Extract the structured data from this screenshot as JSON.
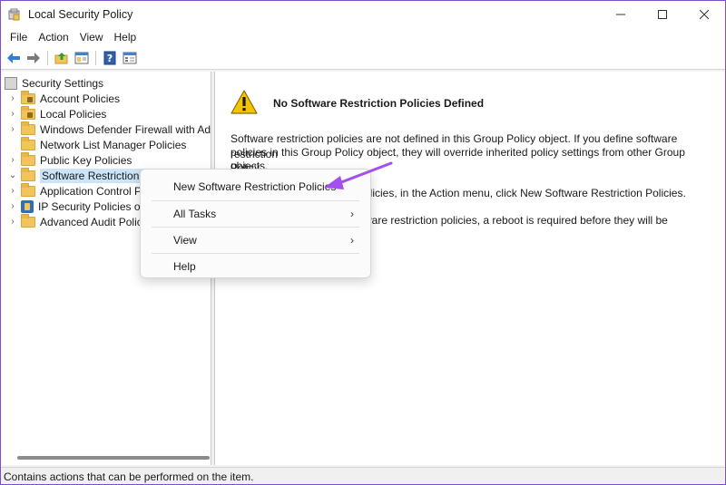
{
  "window": {
    "title": "Local Security Policy",
    "controls": {
      "minimize": "—",
      "maximize": "☐",
      "close": "✕"
    }
  },
  "menubar": {
    "items": [
      "File",
      "Action",
      "View",
      "Help"
    ]
  },
  "toolbar": {
    "buttons": [
      "back-icon",
      "forward-icon",
      "up-folder-icon",
      "show-hide-tree-icon",
      "help-icon",
      "properties-icon"
    ]
  },
  "tree": {
    "root": "Security Settings",
    "items": [
      {
        "label": "Account Policies",
        "icon": "folder-lock-icon",
        "expand": "›"
      },
      {
        "label": "Local Policies",
        "icon": "folder-lock-icon",
        "expand": "›"
      },
      {
        "label": "Windows Defender Firewall with Advar",
        "icon": "folder-icon",
        "expand": "›"
      },
      {
        "label": "Network List Manager Policies",
        "icon": "folder-icon",
        "expand": ""
      },
      {
        "label": "Public Key Policies",
        "icon": "folder-icon",
        "expand": "›"
      },
      {
        "label": "Software Restriction Polici",
        "icon": "folder-icon",
        "expand": "⌄"
      },
      {
        "label": "Application Control Po",
        "icon": "folder-icon",
        "expand": "›"
      },
      {
        "label": "IP Security Policies on I",
        "icon": "ipsec-icon",
        "expand": "›"
      },
      {
        "label": "Advanced Audit Policy",
        "icon": "folder-icon",
        "expand": "›"
      }
    ]
  },
  "content": {
    "heading": "No Software Restriction Policies Defined",
    "para1_line1": "Software restriction policies are not defined in this Group Policy object. If you define software restriction",
    "para1_line2": "policies in this Group Policy object, they will override inherited policy settings from other Group Policy",
    "para1_line3": "objects.",
    "para2": "olicies, in the Action menu, click New Software Restriction Policies.",
    "para3_line1": "ware restriction policies, a reboot is required before they will be"
  },
  "context_menu": {
    "items": [
      {
        "label": "New Software Restriction Policies",
        "submenu": ""
      },
      {
        "label": "All Tasks",
        "submenu": "›"
      },
      {
        "label": "View",
        "submenu": "›"
      },
      {
        "label": "Help",
        "submenu": ""
      }
    ]
  },
  "statusbar": {
    "text": "Contains actions that can be performed on the item."
  },
  "colors": {
    "accent_arrow": "#a64ff0",
    "selection": "#cce4f7",
    "folder": "#f2c55c",
    "window_border": "#7b4fc6"
  }
}
